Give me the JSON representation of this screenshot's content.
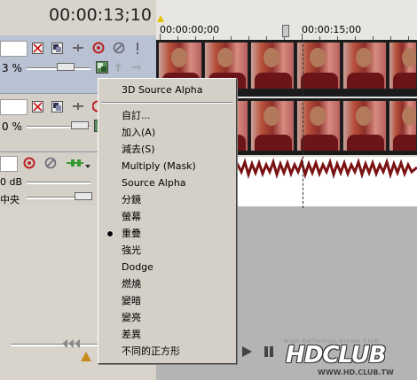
{
  "timecode": "00:00:13;10",
  "ruler": {
    "label_start": "00:00:00;00",
    "label_mid": "00:00:15;00"
  },
  "track1": {
    "percent": "3 %"
  },
  "track2": {
    "percent": "0 %"
  },
  "audio_track": {
    "volume": "0 dB",
    "pan": "中央"
  },
  "context_menu": {
    "items": [
      {
        "label": "3D Source Alpha"
      },
      {
        "label": "自訂..."
      },
      {
        "label": "加入(A)"
      },
      {
        "label": "減去(S)"
      },
      {
        "label": "Multiply (Mask)"
      },
      {
        "label": "Source Alpha"
      },
      {
        "label": "分鏡"
      },
      {
        "label": "螢幕"
      },
      {
        "label": "重疊",
        "selected": true
      },
      {
        "label": "強光"
      },
      {
        "label": "Dodge"
      },
      {
        "label": "燃燒"
      },
      {
        "label": "變暗"
      },
      {
        "label": "變亮"
      },
      {
        "label": "差異"
      },
      {
        "label": "不同的正方形"
      }
    ]
  },
  "watermark": {
    "brand": "HDCLUB",
    "tagline": "High Definition Vision Club",
    "url": "WWW.HD.CLUB.TW"
  },
  "colors": {
    "menu_bg": "#d4d0c8",
    "track_video": "#b9c2d2",
    "audio_wave": "#7a1212"
  }
}
